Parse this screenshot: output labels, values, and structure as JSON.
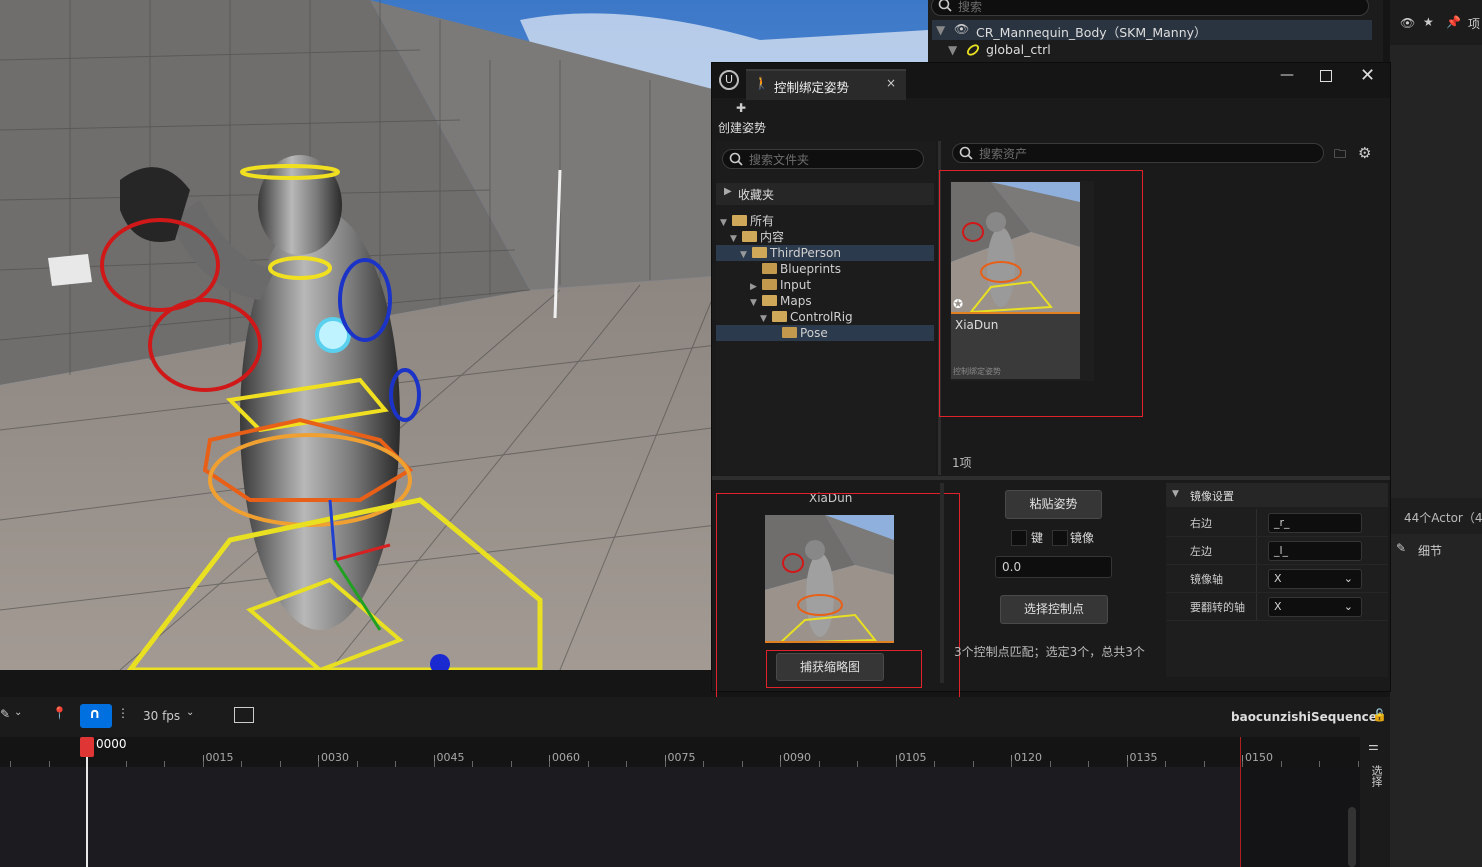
{
  "outliner": {
    "search_placeholder": "搜索",
    "rows": [
      {
        "label": "CR_Mannequin_Body（SKM_Manny）"
      },
      {
        "label": "global_ctrl"
      }
    ]
  },
  "pose_window": {
    "tab_title": "控制绑定姿势",
    "create_pose_label": "创建姿势",
    "folder_search_placeholder": "搜索文件夹",
    "favorites_label": "收藏夹",
    "folders": [
      {
        "label": "所有",
        "indent": 0,
        "selected": false,
        "arrow": "down"
      },
      {
        "label": "内容",
        "indent": 1,
        "selected": false,
        "arrow": "down"
      },
      {
        "label": "ThirdPerson",
        "indent": 2,
        "selected": true,
        "arrow": "down"
      },
      {
        "label": "Blueprints",
        "indent": 3,
        "selected": false,
        "arrow": "none"
      },
      {
        "label": "Input",
        "indent": 3,
        "selected": false,
        "arrow": "right"
      },
      {
        "label": "Maps",
        "indent": 3,
        "selected": false,
        "arrow": "down"
      },
      {
        "label": "ControlRig",
        "indent": 4,
        "selected": false,
        "arrow": "down"
      },
      {
        "label": "Pose",
        "indent": 5,
        "selected": true,
        "arrow": "none"
      }
    ],
    "asset_search_placeholder": "搜索资产",
    "asset": {
      "name": "XiaDun",
      "type_label": "控制绑定姿势"
    },
    "item_count": "1项",
    "preview_title": "XiaDun",
    "capture_thumbnail_button": "捕获缩略图",
    "paste_pose_button": "粘贴姿势",
    "key_label": "键",
    "mirror_label": "镜像",
    "blend_value": "0.0",
    "select_controls_button": "选择控制点",
    "status_text": "3个控制点匹配；选定3个，总共3个",
    "mirror_settings": {
      "header": "镜像设置",
      "rows": [
        {
          "label": "右边",
          "value": "_r_"
        },
        {
          "label": "左边",
          "value": "_l_"
        },
        {
          "label": "镜像轴",
          "value": "X"
        },
        {
          "label": "要翻转的轴",
          "value": "X"
        }
      ]
    }
  },
  "right_panel": {
    "actor_count": "44个Actor（4",
    "details_label": "细节",
    "top_label": "项"
  },
  "timeline": {
    "fps_label": "30 fps",
    "sequence_name": "baocunzishiSequence*",
    "current_frame": "0000",
    "side_label": "选择",
    "ticks": [
      "0015",
      "0030",
      "0045",
      "0060",
      "0075",
      "0090",
      "0105",
      "0120",
      "0135",
      "0150"
    ]
  },
  "colors": {
    "selection_red": "#e0232a",
    "accent_blue": "#0070e0",
    "playhead": "#e03535"
  }
}
